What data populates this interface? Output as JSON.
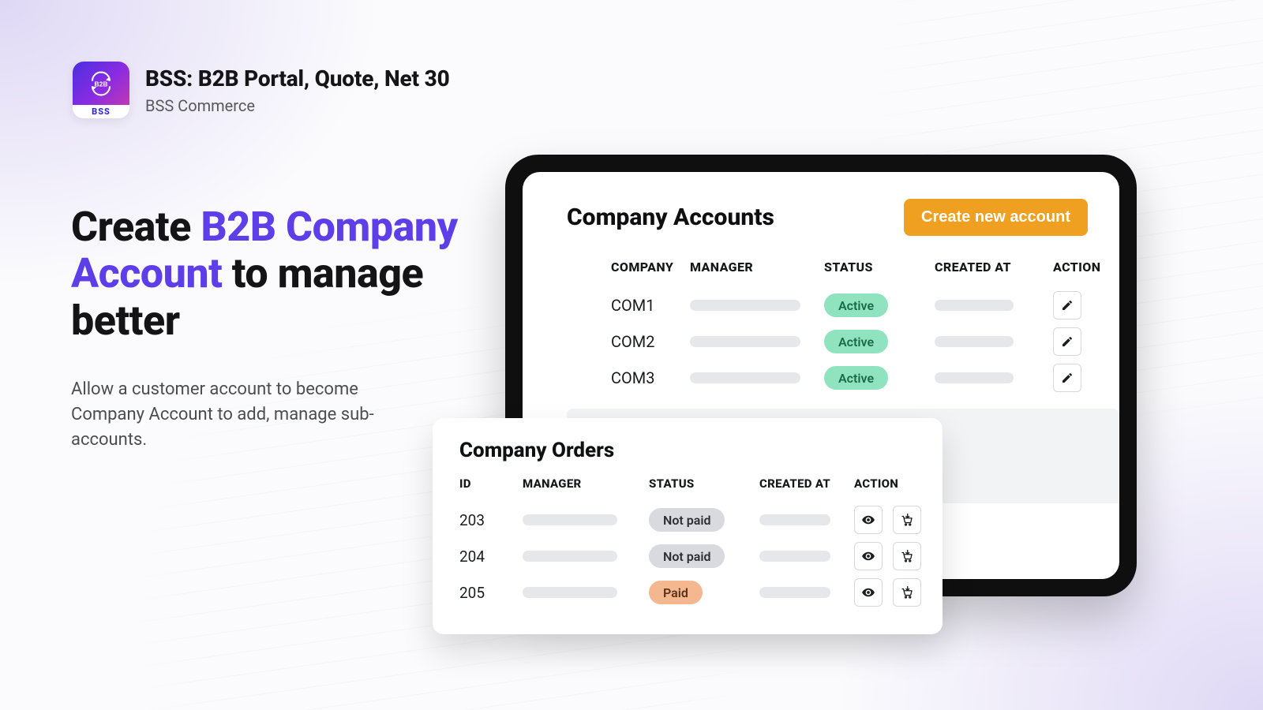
{
  "header": {
    "app_icon_label": "BSS",
    "title": "BSS: B2B Portal, Quote, Net 30",
    "vendor": "BSS Commerce"
  },
  "hero": {
    "headline_pre": "Create ",
    "headline_accent": "B2B Company Account",
    "headline_post": " to manage better",
    "subtext": "Allow a customer account to become Company Account to add, manage sub-accounts."
  },
  "accounts": {
    "title": "Company Accounts",
    "create_label": "Create new account",
    "columns": {
      "company": "COMPANY",
      "manager": "MANAGER",
      "status": "STATUS",
      "created": "CREATED AT",
      "action": "ACTION"
    },
    "rows": [
      {
        "company": "COM1",
        "status": "Active"
      },
      {
        "company": "COM2",
        "status": "Active"
      },
      {
        "company": "COM3",
        "status": "Active"
      }
    ]
  },
  "orders": {
    "title": "Company Orders",
    "columns": {
      "id": "ID",
      "manager": "MANAGER",
      "status": "STATUS",
      "created": "CREATED AT",
      "action": "ACTION"
    },
    "rows": [
      {
        "id": "203",
        "status": "Not paid",
        "status_kind": "notpaid"
      },
      {
        "id": "204",
        "status": "Not paid",
        "status_kind": "notpaid"
      },
      {
        "id": "205",
        "status": "Paid",
        "status_kind": "paid"
      }
    ]
  },
  "colors": {
    "accent_purple": "#5d3ee8",
    "primary_orange": "#f0a020",
    "pill_active": "#8fe3bf",
    "pill_paid": "#f4b790",
    "pill_notpaid": "#d8dadf"
  }
}
